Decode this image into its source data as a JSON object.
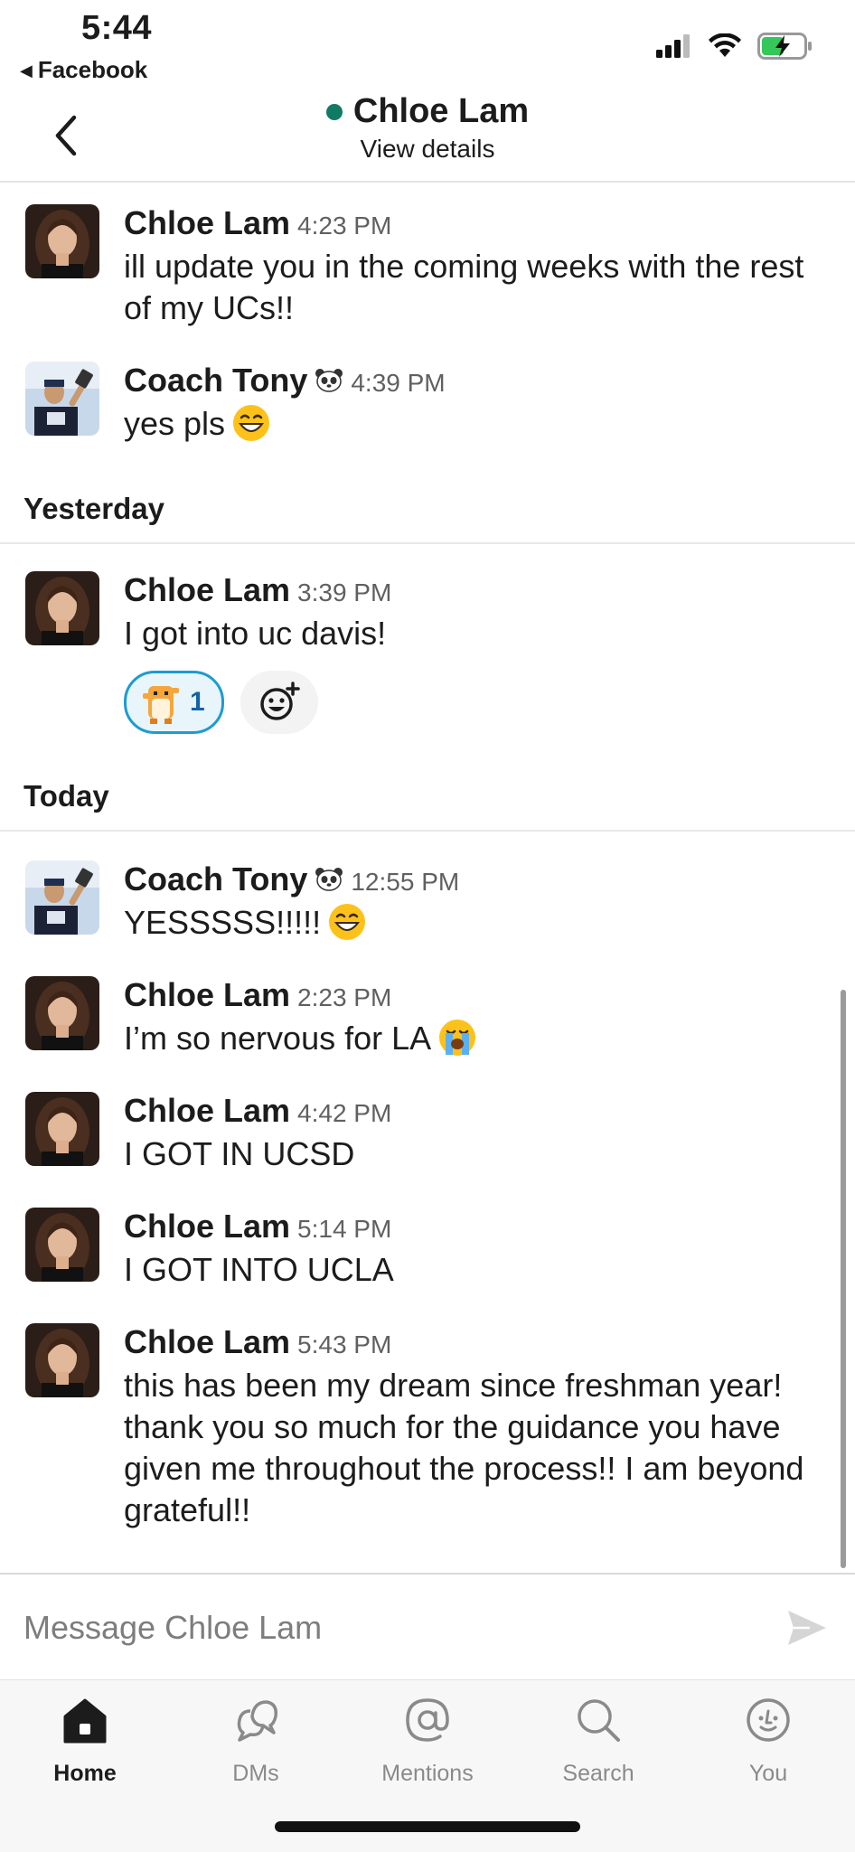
{
  "status_bar": {
    "time": "5:44",
    "back_app": "Facebook"
  },
  "header": {
    "title": "Chloe Lam",
    "subtitle": "View details"
  },
  "messages": [
    {
      "author": "Chloe Lam",
      "time": "4:23 PM",
      "text": "ill update you in the coming weeks with the rest of my UCs!!"
    },
    {
      "author": "Coach Tony",
      "time": "4:39 PM",
      "text": "yes pls",
      "emoji": "grinning-face"
    },
    {
      "divider": "Yesterday"
    },
    {
      "author": "Chloe Lam",
      "time": "3:39 PM",
      "text": "I got into uc davis!",
      "reaction": {
        "emoji": "hamster-dance",
        "count": "1"
      }
    },
    {
      "divider": "Today"
    },
    {
      "author": "Coach Tony",
      "time": "12:55 PM",
      "text": "YESSSSS!!!!!",
      "emoji": "grinning-face"
    },
    {
      "author": "Chloe Lam",
      "time": "2:23 PM",
      "text": "I’m so nervous for LA",
      "emoji": "crying-face"
    },
    {
      "author": "Chloe Lam",
      "time": "4:42 PM",
      "text": "I GOT IN UCSD"
    },
    {
      "author": "Chloe Lam",
      "time": "5:14 PM",
      "text": "I GOT INTO UCLA"
    },
    {
      "author": "Chloe Lam",
      "time": "5:43 PM",
      "text": "this has been my dream since freshman year! thank you so much for the guidance you have given me throughout the process!! I am beyond grateful!!"
    }
  ],
  "composer": {
    "placeholder": "Message Chloe Lam"
  },
  "tabs": [
    {
      "label": "Home",
      "icon": "home-icon",
      "active": true
    },
    {
      "label": "DMs",
      "icon": "dms-icon"
    },
    {
      "label": "Mentions",
      "icon": "mentions-icon"
    },
    {
      "label": "Search",
      "icon": "search-icon"
    },
    {
      "label": "You",
      "icon": "you-icon"
    }
  ],
  "colors": {
    "presence": "#117a65",
    "reaction_border": "#1d9bd1",
    "text": "#1d1c1d"
  }
}
